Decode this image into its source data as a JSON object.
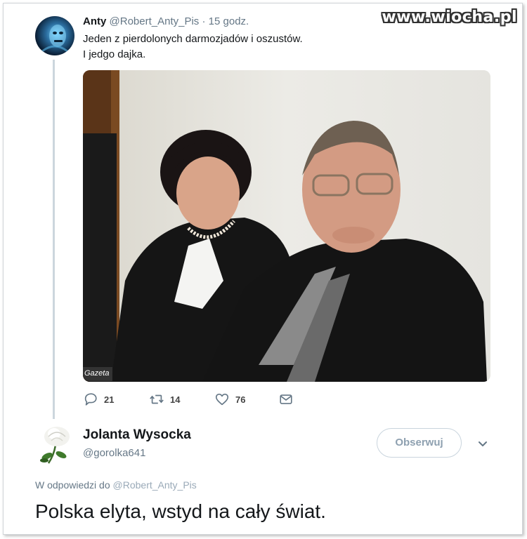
{
  "watermark": "www.wiocha.pl",
  "tweet": {
    "author_name": "Anty",
    "author_handle": "@Robert_Anty_Pis",
    "separator": "·",
    "time": "15 godz.",
    "text_line1": "Jeden z pierdolonych darmozjadów i oszustów.",
    "text_line2": "I jedgo dajka.",
    "photo_credit": "Gazeta",
    "reply_count": "21",
    "retweet_count": "14",
    "like_count": "76",
    "icons": {
      "reply": "comment-icon",
      "retweet": "retweet-icon",
      "like": "heart-icon",
      "dm": "envelope-icon"
    }
  },
  "reply": {
    "author_name": "Jolanta Wysocka",
    "author_handle": "@gorolka641",
    "follow_label": "Obserwuj",
    "reply_to_label": "W odpowiedzi do",
    "reply_to_handle": "@Robert_Anty_Pis",
    "text": "Polska elyta, wstyd na cały świat."
  },
  "colors": {
    "text": "#14171a",
    "secondary": "#657786",
    "thread_line": "#ccd6dd"
  }
}
